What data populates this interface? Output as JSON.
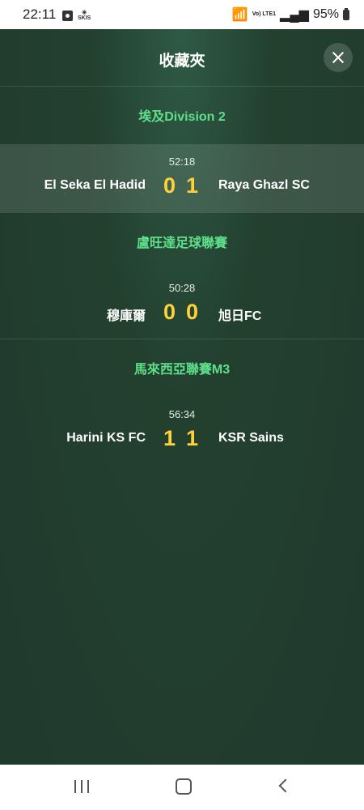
{
  "status_bar": {
    "time": "22:11",
    "skis_label": "SKIS",
    "network_label": "Vo) LTE1",
    "battery": "95%"
  },
  "header": {
    "title": "收藏夾"
  },
  "leagues": [
    {
      "name": "埃及Division 2",
      "matches": [
        {
          "time": "52:18",
          "home": "El Seka El Hadid",
          "home_score": "0",
          "away_score": "1",
          "away": "Raya Ghazl SC"
        }
      ]
    },
    {
      "name": "盧旺達足球聯賽",
      "matches": [
        {
          "time": "50:28",
          "home": "穆庫爾",
          "home_score": "0",
          "away_score": "0",
          "away": "旭日FC"
        }
      ]
    },
    {
      "name": "馬來西亞聯賽M3",
      "matches": [
        {
          "time": "56:34",
          "home": "Harini KS FC",
          "home_score": "1",
          "away_score": "1",
          "away": "KSR Sains"
        }
      ]
    }
  ],
  "colors": {
    "league_text": "#5ee08a",
    "score_text": "#ffd23a",
    "background": "#22392f"
  }
}
